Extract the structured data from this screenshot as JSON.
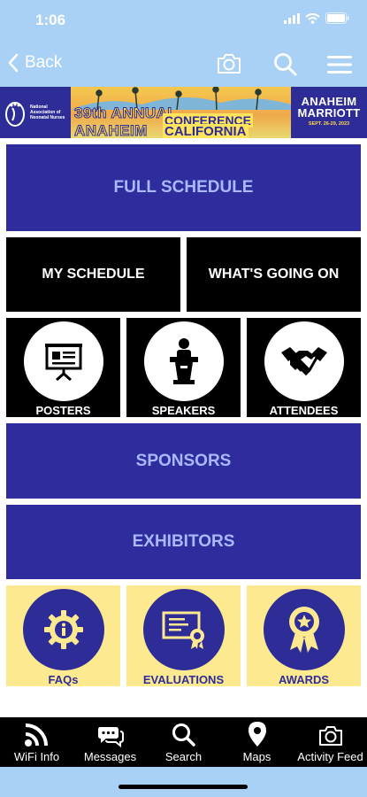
{
  "status": {
    "time": "1:06"
  },
  "nav": {
    "back_label": "Back"
  },
  "banner": {
    "org": "National Association of Neonatal Nurses",
    "line1": "39th ANNUAL",
    "conference": "CONFERENCE",
    "line2": "ANAHEIM",
    "california": "CALIFORNIA",
    "venue1": "ANAHEIM",
    "venue2": "MARRIOTT",
    "dates": "SEPT. 26-29, 2023"
  },
  "tiles": {
    "full_schedule": "FULL SCHEDULE",
    "my_schedule": "MY SCHEDULE",
    "whats_going_on": "WHAT'S GOING ON",
    "posters": "POSTERS",
    "speakers": "SPEAKERS",
    "attendees": "ATTENDEES",
    "sponsors": "SPONSORS",
    "exhibitors": "EXHIBITORS",
    "faqs": "FAQs",
    "evaluations": "EVALUATIONS",
    "awards": "AWARDS"
  },
  "tabs": [
    {
      "label": "WiFi Info",
      "icon": "wifi-icon"
    },
    {
      "label": "Messages",
      "icon": "messages-icon"
    },
    {
      "label": "Search",
      "icon": "search-icon"
    },
    {
      "label": "Maps",
      "icon": "map-pin-icon"
    },
    {
      "label": "Activity Feed",
      "icon": "camera-icon"
    }
  ],
  "colors": {
    "header_bg": "#a9d1f5",
    "tile_blue": "#2f2d9e",
    "tile_blue_text": "#aab9ff",
    "tile_yellow": "#fde990",
    "tile_black": "#000000"
  }
}
